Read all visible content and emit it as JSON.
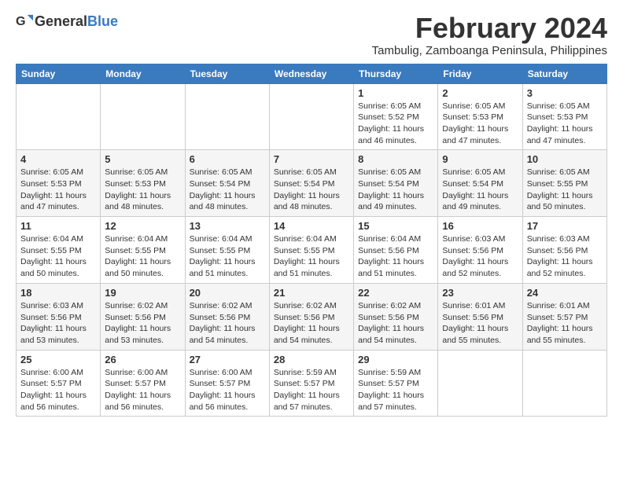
{
  "header": {
    "logo_general": "General",
    "logo_blue": "Blue",
    "month_year": "February 2024",
    "location": "Tambulig, Zamboanga Peninsula, Philippines"
  },
  "weekdays": [
    "Sunday",
    "Monday",
    "Tuesday",
    "Wednesday",
    "Thursday",
    "Friday",
    "Saturday"
  ],
  "weeks": [
    [
      {
        "day": "",
        "info": ""
      },
      {
        "day": "",
        "info": ""
      },
      {
        "day": "",
        "info": ""
      },
      {
        "day": "",
        "info": ""
      },
      {
        "day": "1",
        "info": "Sunrise: 6:05 AM\nSunset: 5:52 PM\nDaylight: 11 hours and 46 minutes."
      },
      {
        "day": "2",
        "info": "Sunrise: 6:05 AM\nSunset: 5:53 PM\nDaylight: 11 hours and 47 minutes."
      },
      {
        "day": "3",
        "info": "Sunrise: 6:05 AM\nSunset: 5:53 PM\nDaylight: 11 hours and 47 minutes."
      }
    ],
    [
      {
        "day": "4",
        "info": "Sunrise: 6:05 AM\nSunset: 5:53 PM\nDaylight: 11 hours and 47 minutes."
      },
      {
        "day": "5",
        "info": "Sunrise: 6:05 AM\nSunset: 5:53 PM\nDaylight: 11 hours and 48 minutes."
      },
      {
        "day": "6",
        "info": "Sunrise: 6:05 AM\nSunset: 5:54 PM\nDaylight: 11 hours and 48 minutes."
      },
      {
        "day": "7",
        "info": "Sunrise: 6:05 AM\nSunset: 5:54 PM\nDaylight: 11 hours and 48 minutes."
      },
      {
        "day": "8",
        "info": "Sunrise: 6:05 AM\nSunset: 5:54 PM\nDaylight: 11 hours and 49 minutes."
      },
      {
        "day": "9",
        "info": "Sunrise: 6:05 AM\nSunset: 5:54 PM\nDaylight: 11 hours and 49 minutes."
      },
      {
        "day": "10",
        "info": "Sunrise: 6:05 AM\nSunset: 5:55 PM\nDaylight: 11 hours and 50 minutes."
      }
    ],
    [
      {
        "day": "11",
        "info": "Sunrise: 6:04 AM\nSunset: 5:55 PM\nDaylight: 11 hours and 50 minutes."
      },
      {
        "day": "12",
        "info": "Sunrise: 6:04 AM\nSunset: 5:55 PM\nDaylight: 11 hours and 50 minutes."
      },
      {
        "day": "13",
        "info": "Sunrise: 6:04 AM\nSunset: 5:55 PM\nDaylight: 11 hours and 51 minutes."
      },
      {
        "day": "14",
        "info": "Sunrise: 6:04 AM\nSunset: 5:55 PM\nDaylight: 11 hours and 51 minutes."
      },
      {
        "day": "15",
        "info": "Sunrise: 6:04 AM\nSunset: 5:56 PM\nDaylight: 11 hours and 51 minutes."
      },
      {
        "day": "16",
        "info": "Sunrise: 6:03 AM\nSunset: 5:56 PM\nDaylight: 11 hours and 52 minutes."
      },
      {
        "day": "17",
        "info": "Sunrise: 6:03 AM\nSunset: 5:56 PM\nDaylight: 11 hours and 52 minutes."
      }
    ],
    [
      {
        "day": "18",
        "info": "Sunrise: 6:03 AM\nSunset: 5:56 PM\nDaylight: 11 hours and 53 minutes."
      },
      {
        "day": "19",
        "info": "Sunrise: 6:02 AM\nSunset: 5:56 PM\nDaylight: 11 hours and 53 minutes."
      },
      {
        "day": "20",
        "info": "Sunrise: 6:02 AM\nSunset: 5:56 PM\nDaylight: 11 hours and 54 minutes."
      },
      {
        "day": "21",
        "info": "Sunrise: 6:02 AM\nSunset: 5:56 PM\nDaylight: 11 hours and 54 minutes."
      },
      {
        "day": "22",
        "info": "Sunrise: 6:02 AM\nSunset: 5:56 PM\nDaylight: 11 hours and 54 minutes."
      },
      {
        "day": "23",
        "info": "Sunrise: 6:01 AM\nSunset: 5:56 PM\nDaylight: 11 hours and 55 minutes."
      },
      {
        "day": "24",
        "info": "Sunrise: 6:01 AM\nSunset: 5:57 PM\nDaylight: 11 hours and 55 minutes."
      }
    ],
    [
      {
        "day": "25",
        "info": "Sunrise: 6:00 AM\nSunset: 5:57 PM\nDaylight: 11 hours and 56 minutes."
      },
      {
        "day": "26",
        "info": "Sunrise: 6:00 AM\nSunset: 5:57 PM\nDaylight: 11 hours and 56 minutes."
      },
      {
        "day": "27",
        "info": "Sunrise: 6:00 AM\nSunset: 5:57 PM\nDaylight: 11 hours and 56 minutes."
      },
      {
        "day": "28",
        "info": "Sunrise: 5:59 AM\nSunset: 5:57 PM\nDaylight: 11 hours and 57 minutes."
      },
      {
        "day": "29",
        "info": "Sunrise: 5:59 AM\nSunset: 5:57 PM\nDaylight: 11 hours and 57 minutes."
      },
      {
        "day": "",
        "info": ""
      },
      {
        "day": "",
        "info": ""
      }
    ]
  ]
}
